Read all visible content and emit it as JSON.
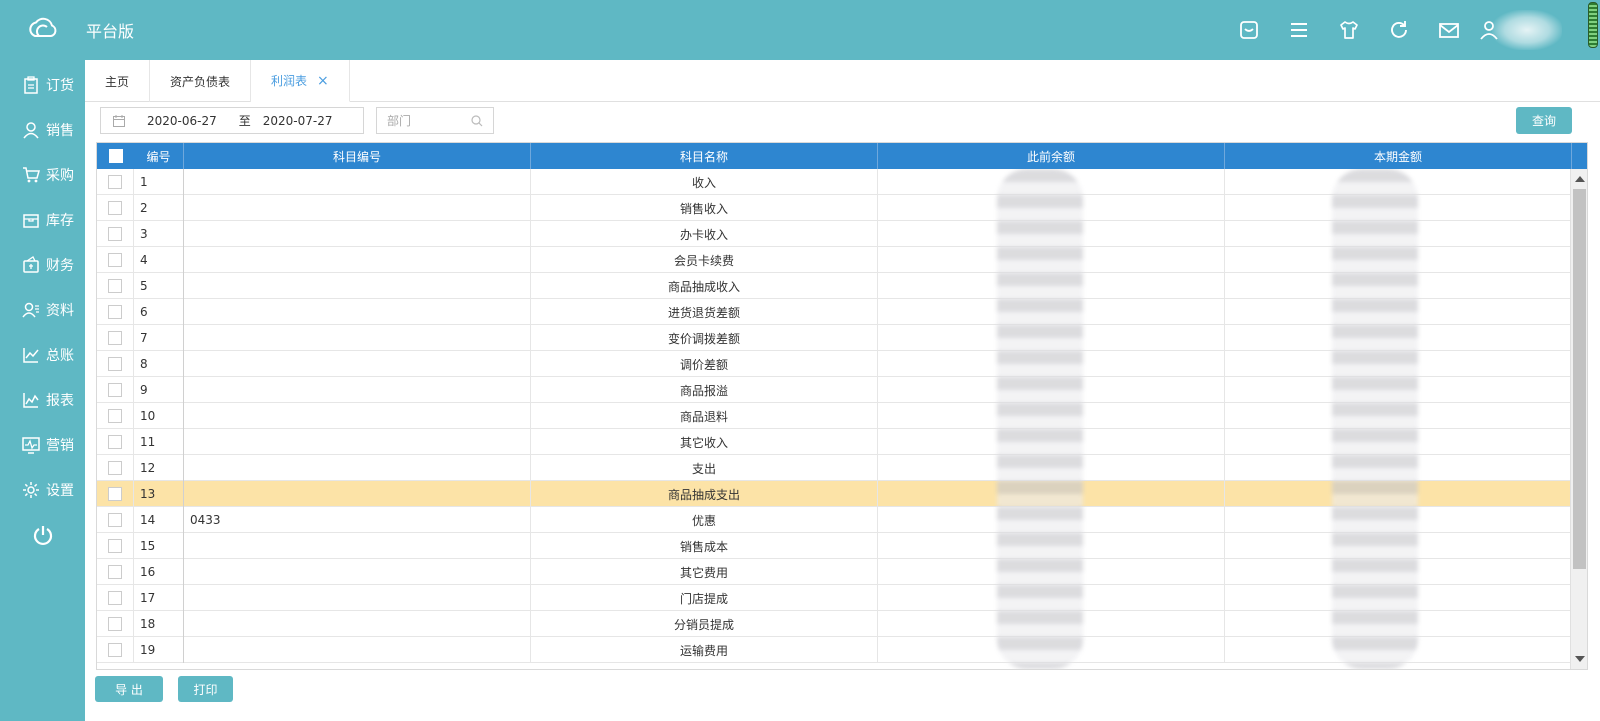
{
  "app": {
    "title": "平台版"
  },
  "header": {
    "icons": [
      "message-icon",
      "menu-icon",
      "shirt-icon",
      "refresh-icon",
      "mail-icon",
      "user-icon"
    ]
  },
  "sidebar": {
    "items": [
      {
        "label": "订货",
        "icon": "clipboard-icon"
      },
      {
        "label": "销售",
        "icon": "user-icon"
      },
      {
        "label": "采购",
        "icon": "cart-icon"
      },
      {
        "label": "库存",
        "icon": "box-icon"
      },
      {
        "label": "财务",
        "icon": "wallet-icon"
      },
      {
        "label": "资料",
        "icon": "contacts-icon"
      },
      {
        "label": "总账",
        "icon": "chart-icon"
      },
      {
        "label": "报表",
        "icon": "report-icon"
      },
      {
        "label": "营销",
        "icon": "pulse-icon"
      },
      {
        "label": "设置",
        "icon": "gear-icon"
      }
    ]
  },
  "tabs": [
    {
      "label": "主页"
    },
    {
      "label": "资产负债表"
    },
    {
      "label": "利润表",
      "active": true,
      "close": "×"
    }
  ],
  "filters": {
    "date_from": "2020-06-27",
    "date_sep": "至",
    "date_to": "2020-07-27",
    "dept_placeholder": "部门",
    "query_label": "查询"
  },
  "table": {
    "headers": [
      "编号",
      "科目编号",
      "科目名称",
      "此前余额",
      "本期金额"
    ],
    "rows": [
      {
        "no": "1",
        "code": "",
        "name": "收入"
      },
      {
        "no": "2",
        "code": "",
        "name": "销售收入"
      },
      {
        "no": "3",
        "code": "",
        "name": "办卡收入"
      },
      {
        "no": "4",
        "code": "",
        "name": "会员卡续费"
      },
      {
        "no": "5",
        "code": "",
        "name": "商品抽成收入"
      },
      {
        "no": "6",
        "code": "",
        "name": "进货退货差额"
      },
      {
        "no": "7",
        "code": "",
        "name": "变价调拨差额"
      },
      {
        "no": "8",
        "code": "",
        "name": "调价差额"
      },
      {
        "no": "9",
        "code": "",
        "name": "商品报溢"
      },
      {
        "no": "10",
        "code": "",
        "name": "商品退料"
      },
      {
        "no": "11",
        "code": "",
        "name": "其它收入"
      },
      {
        "no": "12",
        "code": "",
        "name": "支出"
      },
      {
        "no": "13",
        "code": "",
        "name": "商品抽成支出",
        "highlight": true
      },
      {
        "no": "14",
        "code": "0433",
        "name": "优惠"
      },
      {
        "no": "15",
        "code": "",
        "name": "销售成本"
      },
      {
        "no": "16",
        "code": "",
        "name": "其它费用"
      },
      {
        "no": "17",
        "code": "",
        "name": "门店提成"
      },
      {
        "no": "18",
        "code": "",
        "name": "分销员提成"
      },
      {
        "no": "19",
        "code": "",
        "name": "运输费用"
      }
    ]
  },
  "footer": {
    "export_label": "导 出",
    "print_label": "打印"
  },
  "colors": {
    "primary": "#5fb8c4",
    "header_blue": "#2e86d0",
    "highlight_row": "#fce3a7",
    "active_tab": "#4a9de0"
  }
}
